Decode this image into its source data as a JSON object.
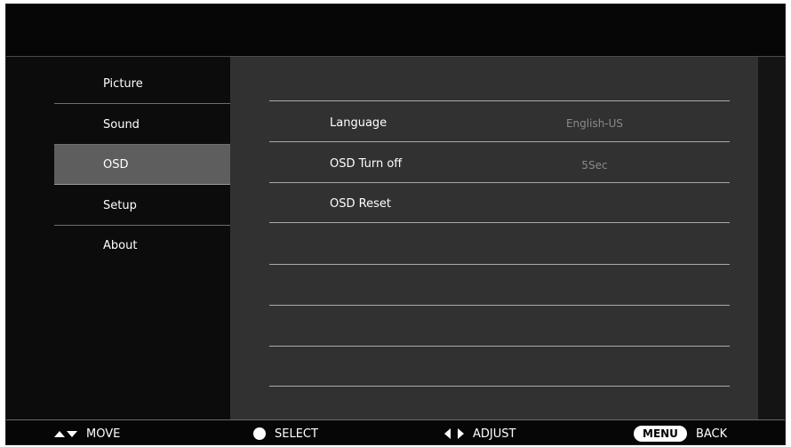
{
  "sidebar": {
    "items": [
      {
        "label": "Picture"
      },
      {
        "label": "Sound"
      },
      {
        "label": "OSD"
      },
      {
        "label": "Setup"
      },
      {
        "label": "About"
      }
    ],
    "selected": "OSD"
  },
  "osd": {
    "rows": [
      {
        "label": "Language",
        "value": "English-US"
      },
      {
        "label": "OSD Turn off",
        "value": "5Sec"
      },
      {
        "label": "OSD Reset",
        "value": ""
      }
    ]
  },
  "footer": {
    "move": {
      "icon": "up-down-arrows-icon",
      "label": "MOVE"
    },
    "select": {
      "icon": "circle-dot-icon",
      "label": "SELECT"
    },
    "adjust": {
      "icon": "left-right-arrows-icon",
      "label": "ADJUST"
    },
    "back": {
      "key": "MENU",
      "label": "BACK"
    }
  },
  "colors": {
    "background": "#060606",
    "panel": "#313131",
    "selected": "#5e5e5e",
    "text": "#ffffff",
    "value_text": "#8a8a8a"
  }
}
